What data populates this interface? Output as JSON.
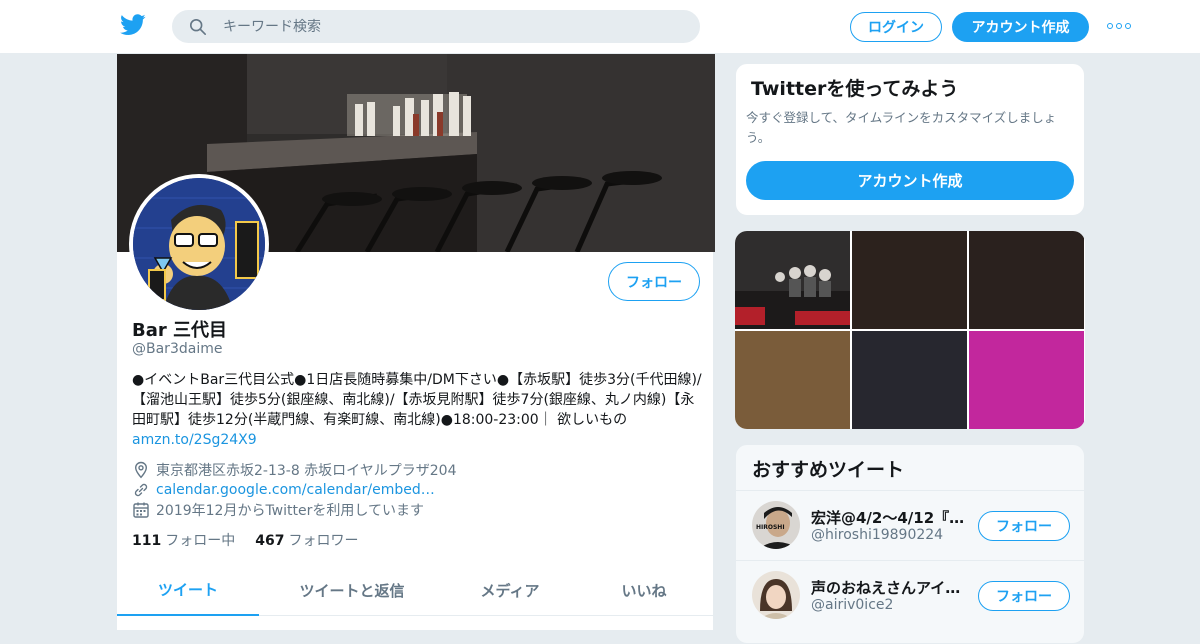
{
  "header": {
    "search_placeholder": "キーワード検索",
    "login_label": "ログイン",
    "signup_label": "アカウント作成"
  },
  "profile": {
    "name": "Bar 三代目",
    "handle": "@Bar3daime",
    "follow_label": "フォロー",
    "bio_text": "●イベントBar三代目公式●1日店長随時募集中/DM下さい●【赤坂駅】徒歩3分(千代田線)/【溜池山王駅】徒歩5分(銀座線、南北線)/【赤坂見附駅】徒歩7分(銀座線、丸ノ内線)【永田町駅】徒歩12分(半蔵門線、有楽町線、南北線)●18:00-23:00｜ 欲しいもの",
    "bio_link": "amzn.to/2Sg24X9",
    "location": "東京都港区赤坂2-13-8 赤坂ロイヤルプラザ204",
    "url": "calendar.google.com/calendar/embed…",
    "joined": "2019年12月からTwitterを利用しています",
    "following_count": "111",
    "following_label": "フォロー中",
    "followers_count": "467",
    "followers_label": "フォロワー",
    "avatar_text": {
      "left": "1日バーテン",
      "right": "募集!!",
      "tag1": "三代目",
      "tag2": "三代目"
    }
  },
  "tabs": [
    "ツイート",
    "ツイートと返信",
    "メディア",
    "いいね"
  ],
  "try_card": {
    "title": "Twitterを使ってみよう",
    "text": "今すぐ登録して、タイムラインをカスタマイズしましょう。",
    "button": "アカウント作成"
  },
  "recommended": {
    "title": "おすすめツイート",
    "users": [
      {
        "name": "宏洋@4/2〜4/12『へ…",
        "handle": "@hiroshi19890224",
        "button": "フォロー",
        "avatar_text": "HIROSHI"
      },
      {
        "name": "声のおねえさんアイ…",
        "handle": "@airiv0ice2",
        "button": "フォロー"
      }
    ]
  },
  "media_colors": [
    "#3a3838",
    "#2c221d",
    "#2a211e",
    "#7a5c3a",
    "#27272f",
    "#c2279d"
  ],
  "colors": {
    "accent": "#1da1f2",
    "link": "#1b95e0",
    "muted": "#657786"
  },
  "icons": [
    "twitter-bird-icon",
    "search-icon",
    "more-dots-icon",
    "location-icon",
    "link-icon",
    "calendar-icon"
  ]
}
